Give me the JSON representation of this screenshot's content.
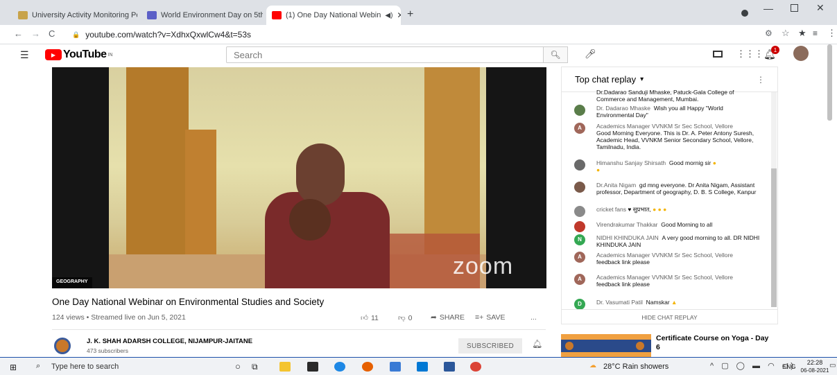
{
  "browser": {
    "tabs": [
      {
        "title": "University Activity Monitoring Po",
        "color": "#c8a34a"
      },
      {
        "title": "World Environment Day on 5th J",
        "color": "#5b5fc7"
      },
      {
        "title": "(1) One Day National Webin",
        "color": "#ff0000"
      }
    ],
    "url": "youtube.com/watch?v=XdhxQxwlCw4&t=53s"
  },
  "youtube": {
    "logo_text": "YouTube",
    "logo_region": "IN",
    "search_placeholder": "Search",
    "notif_count": "1"
  },
  "video": {
    "category_label": "GEOGRAPHY",
    "watermark": "zoom",
    "title": "One Day National Webinar on Environmental Studies and Society",
    "meta": "124 views • Streamed live on Jun 5, 2021",
    "likes": "11",
    "dislikes": "0",
    "share_label": "SHARE",
    "save_label": "SAVE",
    "more_label": "..."
  },
  "channel": {
    "name": "J. K. SHAH ADARSH COLLEGE, NIJAMPUR-JAITANE",
    "subs": "473 subscribers",
    "subscribe_label": "SUBSCRIBED"
  },
  "chat": {
    "header": "Top chat replay",
    "hide_label": "HIDE CHAT REPLAY",
    "messages": [
      {
        "author": "",
        "text": "Dr.Dadarao Sanduji Mhaske, Patuck-Gala College of Commerce and Management, Mumbai.",
        "initial": "",
        "color": ""
      },
      {
        "author": "Dr. Dadarao Mhaske",
        "text": "Wish you all Happy \"World Environmental Day\"",
        "initial": "",
        "color": "#5a7d4a"
      },
      {
        "author": "Academics Manager VVNKM Sr Sec School, Vellore",
        "text": "Good Morning Everyone. This is Dr. A. Peter Antony Suresh, Academic Head, VVNKM Senior Secondary School, Vellore, Tamilnadu, India.",
        "initial": "A",
        "color": "#a0675a"
      },
      {
        "author": "Himanshu Sanjay Shirsath",
        "text": "Good mornig sir",
        "initial": "",
        "color": "#6a6a6a"
      },
      {
        "author": "Dr.Anita Nigam",
        "text": "gd mng everyone. Dr Anita Nigam, Assistant professor, Department of geography, D. B. S College, Kanpur",
        "initial": "",
        "color": "#7a5a4a"
      },
      {
        "author": "cricket fans",
        "text": "♥ सुप्रभात,",
        "initial": "",
        "color": "#8a8a8a"
      },
      {
        "author": "Virendrakumar Thakkar",
        "text": "Good Morning to all",
        "initial": "",
        "color": "#c0392b"
      },
      {
        "author": "NIDHI KHINDUKA JAIN",
        "text": "A very good morning to all. DR NIDHI KHINDUKA JAIN",
        "initial": "N",
        "color": "#34a853"
      },
      {
        "author": "Academics Manager VVNKM Sr Sec School, Vellore",
        "text": "feedback link please",
        "initial": "A",
        "color": "#a0675a"
      },
      {
        "author": "Academics Manager VVNKM Sr Sec School, Vellore",
        "text": "feedback link please",
        "initial": "A",
        "color": "#a0675a"
      },
      {
        "author": "Dr. Vasumati Patil",
        "text": "Namskar",
        "initial": "D",
        "color": "#34a853"
      }
    ]
  },
  "recommended": {
    "title": "Certificate Course on Yoga - Day 6"
  },
  "taskbar": {
    "search_placeholder": "Type here to search",
    "weather": "28°C  Rain showers",
    "lang": "ENG",
    "time": "22:28",
    "date": "06-08-2021"
  }
}
